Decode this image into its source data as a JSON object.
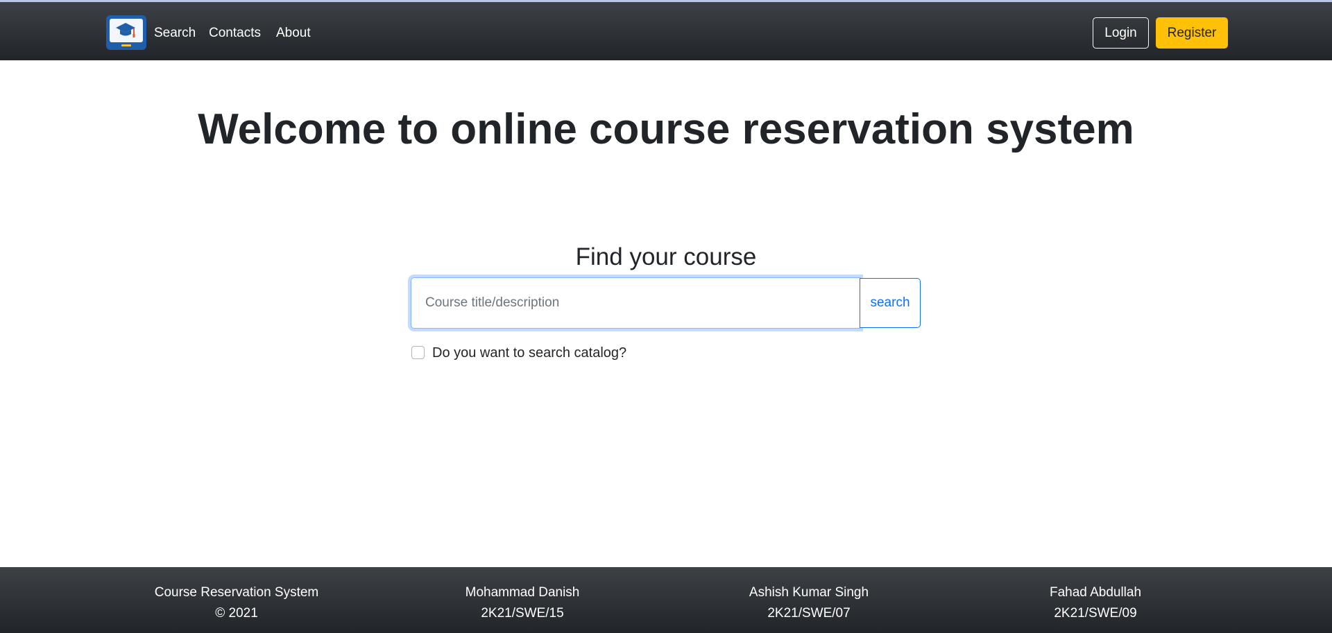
{
  "navbar": {
    "logo_icon": "graduation-cap-laptop-icon",
    "links": [
      "Search",
      "Contacts",
      "About"
    ],
    "login_label": "Login",
    "register_label": "Register"
  },
  "hero": {
    "title": "Welcome to online course reservation system"
  },
  "search": {
    "title": "Find your course",
    "placeholder": "Course title/description",
    "value": "",
    "button_label": "search",
    "catalog_checkbox_label": "Do you want to search catalog?",
    "catalog_checked": false
  },
  "footer": {
    "columns": [
      {
        "line1": "Course Reservation System",
        "line2": "© 2021"
      },
      {
        "line1": "Mohammad Danish",
        "line2": "2K21/SWE/15"
      },
      {
        "line1": "Ashish Kumar Singh",
        "line2": "2K21/SWE/07"
      },
      {
        "line1": "Fahad Abdullah",
        "line2": "2K21/SWE/09"
      }
    ]
  },
  "colors": {
    "navbar": "#212529",
    "register_button": "#ffc107",
    "primary": "#0d6efd"
  }
}
